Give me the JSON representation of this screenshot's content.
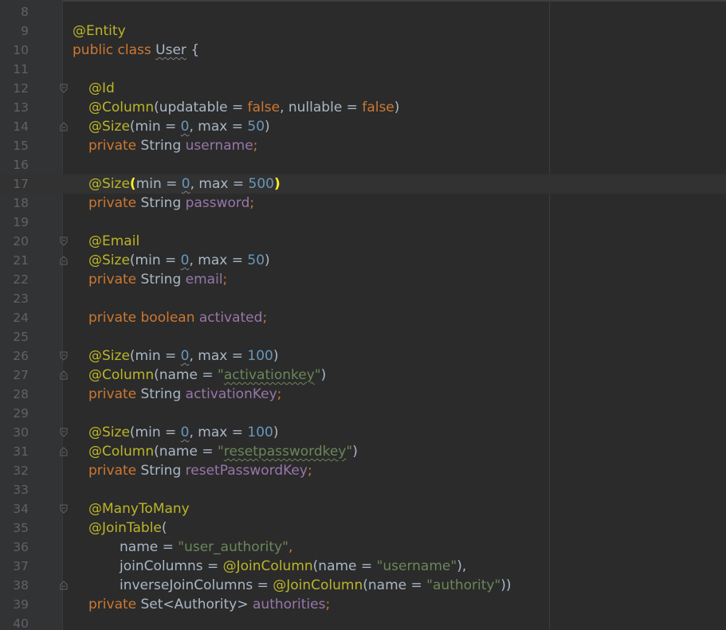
{
  "editor": {
    "language": "java",
    "first_line_number": 8,
    "current_line": 17,
    "colors": {
      "background": "#2b2b2b",
      "gutter": "#313335",
      "line_number": "#606366",
      "annotation": "#bbb529",
      "keyword": "#cc7832",
      "plain": "#a9b7c6",
      "field": "#9876aa",
      "number": "#6897bb",
      "string": "#6a8759",
      "bracket_highlight": "#ffef28",
      "current_line": "#323232"
    },
    "lines": [
      {
        "number": "8",
        "indent": 0,
        "tokens": []
      },
      {
        "number": "9",
        "indent": 0,
        "tokens": [
          {
            "text": "@Entity",
            "type": "annotation"
          }
        ]
      },
      {
        "number": "10",
        "indent": 0,
        "tokens": [
          {
            "text": "public class ",
            "type": "keyword"
          },
          {
            "text": "User",
            "type": "classname",
            "underline": "weak"
          },
          {
            "text": " {",
            "type": "plain"
          }
        ]
      },
      {
        "number": "11",
        "indent": 0,
        "tokens": []
      },
      {
        "number": "12",
        "indent": 1,
        "fold": "start",
        "tokens": [
          {
            "text": "@Id",
            "type": "annotation"
          }
        ]
      },
      {
        "number": "13",
        "indent": 1,
        "tokens": [
          {
            "text": "@Column",
            "type": "annotation"
          },
          {
            "text": "(updatable = ",
            "type": "plain"
          },
          {
            "text": "false",
            "type": "keyword"
          },
          {
            "text": ", nullable = ",
            "type": "plain"
          },
          {
            "text": "false",
            "type": "keyword"
          },
          {
            "text": ")",
            "type": "plain"
          }
        ]
      },
      {
        "number": "14",
        "indent": 1,
        "fold": "end",
        "tokens": [
          {
            "text": "@Size",
            "type": "annotation"
          },
          {
            "text": "(min = ",
            "type": "plain"
          },
          {
            "text": "0",
            "type": "number",
            "underline": "weak"
          },
          {
            "text": ", max = ",
            "type": "plain"
          },
          {
            "text": "50",
            "type": "number"
          },
          {
            "text": ")",
            "type": "plain"
          }
        ]
      },
      {
        "number": "15",
        "indent": 1,
        "tokens": [
          {
            "text": "private ",
            "type": "keyword"
          },
          {
            "text": "String ",
            "type": "plain"
          },
          {
            "text": "username",
            "type": "field"
          },
          {
            "text": ";",
            "type": "keyword"
          }
        ]
      },
      {
        "number": "16",
        "indent": 0,
        "tokens": []
      },
      {
        "number": "17",
        "indent": 1,
        "tokens": [
          {
            "text": "@Size",
            "type": "annotation"
          },
          {
            "text": "(",
            "type": "bracket"
          },
          {
            "text": "min = ",
            "type": "plain"
          },
          {
            "text": "0",
            "type": "number",
            "underline": "weak"
          },
          {
            "text": ", max = ",
            "type": "plain"
          },
          {
            "text": "500",
            "type": "number"
          },
          {
            "text": ")",
            "type": "bracket"
          }
        ]
      },
      {
        "number": "18",
        "indent": 1,
        "tokens": [
          {
            "text": "private ",
            "type": "keyword"
          },
          {
            "text": "String ",
            "type": "plain"
          },
          {
            "text": "password",
            "type": "field"
          },
          {
            "text": ";",
            "type": "keyword"
          }
        ]
      },
      {
        "number": "19",
        "indent": 0,
        "tokens": []
      },
      {
        "number": "20",
        "indent": 1,
        "fold": "start",
        "tokens": [
          {
            "text": "@Email",
            "type": "annotation"
          }
        ]
      },
      {
        "number": "21",
        "indent": 1,
        "fold": "end",
        "tokens": [
          {
            "text": "@Size",
            "type": "annotation"
          },
          {
            "text": "(min = ",
            "type": "plain"
          },
          {
            "text": "0",
            "type": "number",
            "underline": "weak"
          },
          {
            "text": ", max = ",
            "type": "plain"
          },
          {
            "text": "50",
            "type": "number"
          },
          {
            "text": ")",
            "type": "plain"
          }
        ]
      },
      {
        "number": "22",
        "indent": 1,
        "tokens": [
          {
            "text": "private ",
            "type": "keyword"
          },
          {
            "text": "String ",
            "type": "plain"
          },
          {
            "text": "email",
            "type": "field"
          },
          {
            "text": ";",
            "type": "keyword"
          }
        ]
      },
      {
        "number": "23",
        "indent": 0,
        "tokens": []
      },
      {
        "number": "24",
        "indent": 1,
        "tokens": [
          {
            "text": "private boolean ",
            "type": "keyword"
          },
          {
            "text": "activated",
            "type": "field"
          },
          {
            "text": ";",
            "type": "keyword"
          }
        ]
      },
      {
        "number": "25",
        "indent": 0,
        "tokens": []
      },
      {
        "number": "26",
        "indent": 1,
        "fold": "start",
        "tokens": [
          {
            "text": "@Size",
            "type": "annotation"
          },
          {
            "text": "(min = ",
            "type": "plain"
          },
          {
            "text": "0",
            "type": "number",
            "underline": "weak"
          },
          {
            "text": ", max = ",
            "type": "plain"
          },
          {
            "text": "100",
            "type": "number"
          },
          {
            "text": ")",
            "type": "plain"
          }
        ]
      },
      {
        "number": "27",
        "indent": 1,
        "fold": "end",
        "tokens": [
          {
            "text": "@Column",
            "type": "annotation"
          },
          {
            "text": "(name = ",
            "type": "plain"
          },
          {
            "text": "\"",
            "type": "string"
          },
          {
            "text": "activationkey",
            "type": "string",
            "underline": "typo"
          },
          {
            "text": "\"",
            "type": "string"
          },
          {
            "text": ")",
            "type": "plain"
          }
        ]
      },
      {
        "number": "28",
        "indent": 1,
        "tokens": [
          {
            "text": "private ",
            "type": "keyword"
          },
          {
            "text": "String ",
            "type": "plain"
          },
          {
            "text": "activationKey",
            "type": "field"
          },
          {
            "text": ";",
            "type": "keyword"
          }
        ]
      },
      {
        "number": "29",
        "indent": 0,
        "tokens": []
      },
      {
        "number": "30",
        "indent": 1,
        "fold": "start",
        "tokens": [
          {
            "text": "@Size",
            "type": "annotation"
          },
          {
            "text": "(min = ",
            "type": "plain"
          },
          {
            "text": "0",
            "type": "number",
            "underline": "weak"
          },
          {
            "text": ", max = ",
            "type": "plain"
          },
          {
            "text": "100",
            "type": "number"
          },
          {
            "text": ")",
            "type": "plain"
          }
        ]
      },
      {
        "number": "31",
        "indent": 1,
        "fold": "end",
        "tokens": [
          {
            "text": "@Column",
            "type": "annotation"
          },
          {
            "text": "(name = ",
            "type": "plain"
          },
          {
            "text": "\"",
            "type": "string"
          },
          {
            "text": "resetpasswordkey",
            "type": "string",
            "underline": "typo"
          },
          {
            "text": "\"",
            "type": "string"
          },
          {
            "text": ")",
            "type": "plain"
          }
        ]
      },
      {
        "number": "32",
        "indent": 1,
        "tokens": [
          {
            "text": "private ",
            "type": "keyword"
          },
          {
            "text": "String ",
            "type": "plain"
          },
          {
            "text": "resetPasswordKey",
            "type": "field"
          },
          {
            "text": ";",
            "type": "keyword"
          }
        ]
      },
      {
        "number": "33",
        "indent": 0,
        "tokens": []
      },
      {
        "number": "34",
        "indent": 1,
        "fold": "start",
        "tokens": [
          {
            "text": "@ManyToMany",
            "type": "annotation"
          }
        ]
      },
      {
        "number": "35",
        "indent": 1,
        "tokens": [
          {
            "text": "@JoinTable",
            "type": "annotation"
          },
          {
            "text": "(",
            "type": "plain"
          }
        ]
      },
      {
        "number": "36",
        "indent": 2,
        "tokens": [
          {
            "text": "name = ",
            "type": "plain"
          },
          {
            "text": "\"user_authority\"",
            "type": "string"
          },
          {
            "text": ",",
            "type": "keyword"
          }
        ]
      },
      {
        "number": "37",
        "indent": 2,
        "tokens": [
          {
            "text": "joinColumns = ",
            "type": "plain"
          },
          {
            "text": "@JoinColumn",
            "type": "annotation"
          },
          {
            "text": "(name = ",
            "type": "plain"
          },
          {
            "text": "\"username\"",
            "type": "string"
          },
          {
            "text": "),",
            "type": "plain"
          }
        ]
      },
      {
        "number": "38",
        "indent": 2,
        "fold": "end",
        "tokens": [
          {
            "text": "inverseJoinColumns = ",
            "type": "plain"
          },
          {
            "text": "@JoinColumn",
            "type": "annotation"
          },
          {
            "text": "(name = ",
            "type": "plain"
          },
          {
            "text": "\"authority\"",
            "type": "string"
          },
          {
            "text": "))",
            "type": "plain"
          }
        ]
      },
      {
        "number": "39",
        "indent": 1,
        "tokens": [
          {
            "text": "private ",
            "type": "keyword"
          },
          {
            "text": "Set<Authority> ",
            "type": "plain"
          },
          {
            "text": "authorities",
            "type": "field"
          },
          {
            "text": ";",
            "type": "keyword"
          }
        ]
      },
      {
        "number": "40",
        "indent": 0,
        "tokens": []
      }
    ]
  }
}
